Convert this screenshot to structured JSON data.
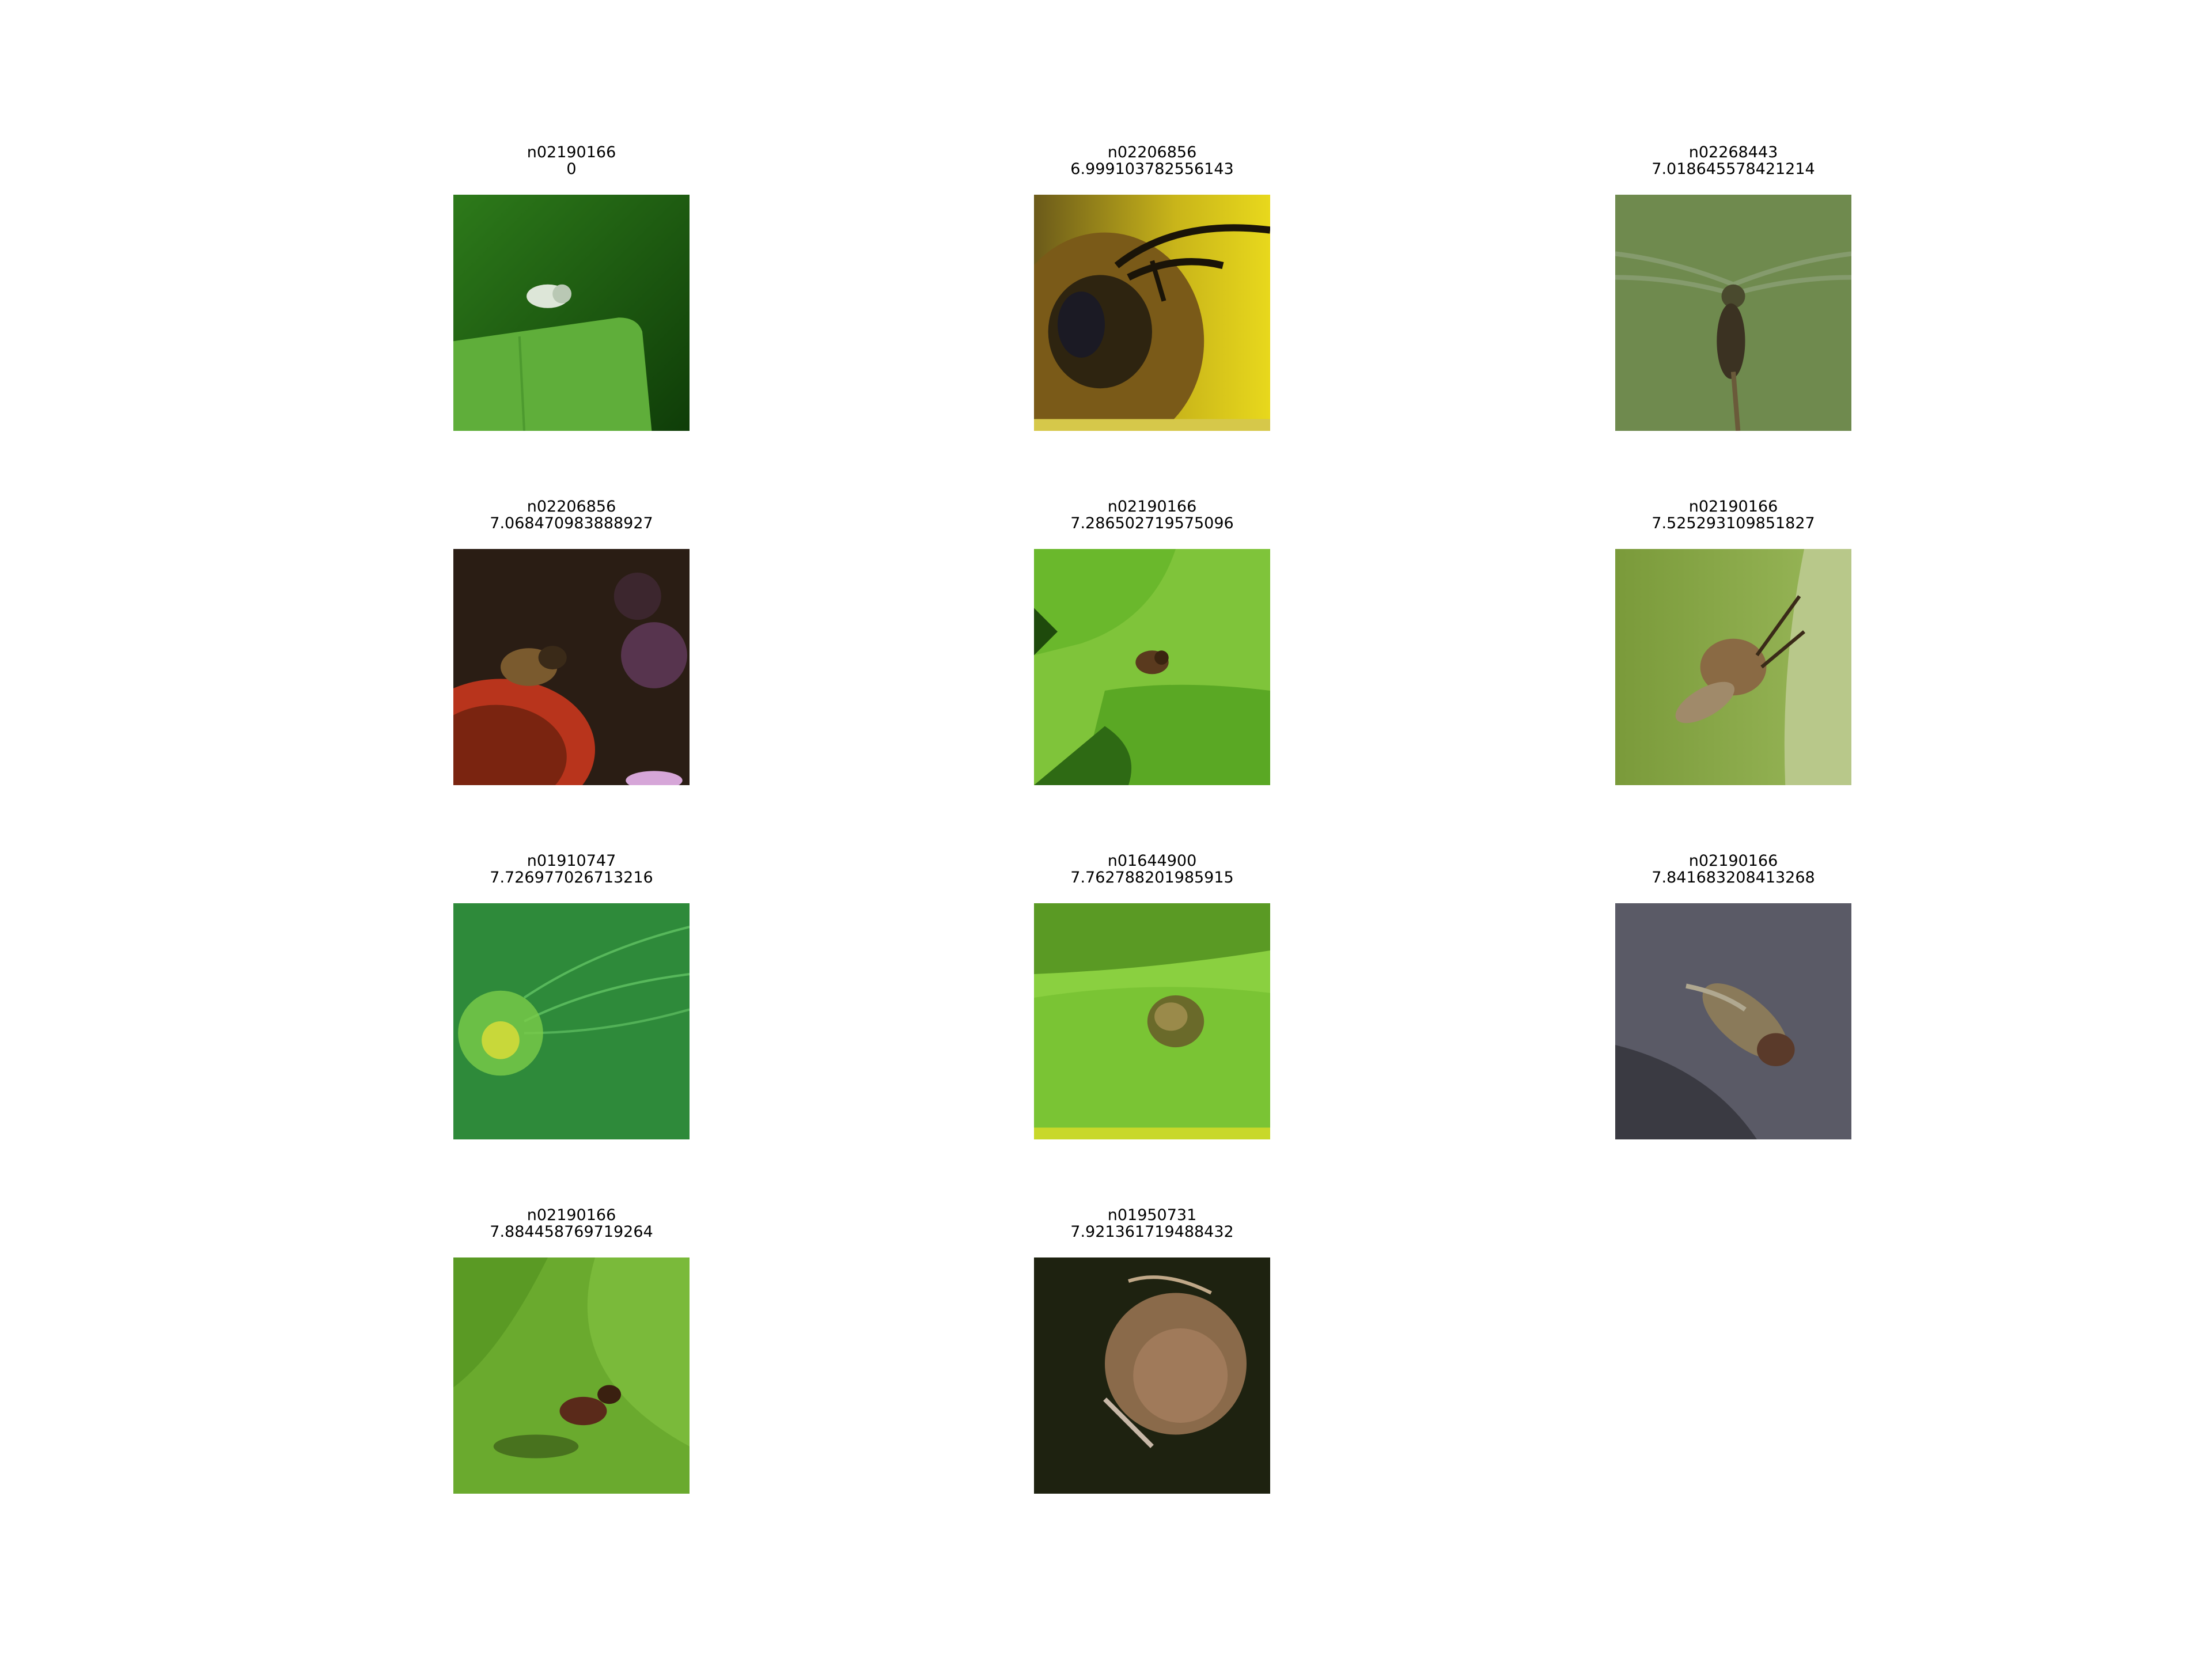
{
  "panels": [
    {
      "label": "n02190166",
      "score": "0",
      "subject": "small white insect on green leaf"
    },
    {
      "label": "n02206856",
      "score": "6.999103782556143",
      "subject": "close-up of bee head on yellow background"
    },
    {
      "label": "n02268443",
      "score": "7.018645578421214",
      "subject": "dragonfly on stem, green background"
    },
    {
      "label": "n02206856",
      "score": "7.068470983888927",
      "subject": "bee on orange coneflower"
    },
    {
      "label": "n02190166",
      "score": "7.286502719575096",
      "subject": "small fly on bright green leaves"
    },
    {
      "label": "n02190166",
      "score": "7.525293109851827",
      "subject": "fly on grass stem"
    },
    {
      "label": "n01910747",
      "score": "7.726977026713216",
      "subject": "green fuzzy jellyfish-like organism"
    },
    {
      "label": "n01644900",
      "score": "7.762788201985915",
      "subject": "small frog on lily pad"
    },
    {
      "label": "n02190166",
      "score": "7.841683208413268",
      "subject": "fly on dark grey surface"
    },
    {
      "label": "n02190166",
      "score": "7.884458769719264",
      "subject": "fly on green leaf with shadow"
    },
    {
      "label": "n01950731",
      "score": "7.921361719488432",
      "subject": "sea slug on dark background"
    }
  ]
}
